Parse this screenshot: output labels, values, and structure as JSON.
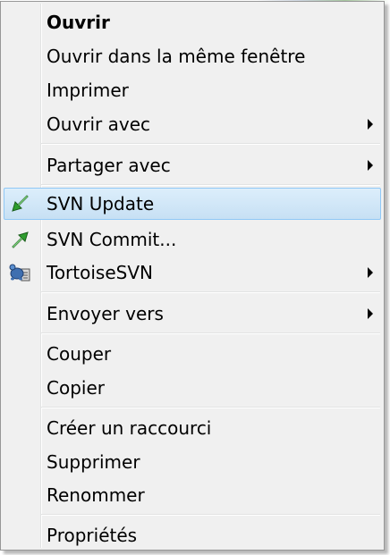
{
  "menu": {
    "items": [
      {
        "label": "Ouvrir"
      },
      {
        "label": "Ouvrir dans la même fenêtre"
      },
      {
        "label": "Imprimer"
      },
      {
        "label": "Ouvrir avec"
      },
      {
        "label": "Partager avec"
      },
      {
        "label": "SVN Update"
      },
      {
        "label": "SVN Commit..."
      },
      {
        "label": "TortoiseSVN"
      },
      {
        "label": "Envoyer vers"
      },
      {
        "label": "Couper"
      },
      {
        "label": "Copier"
      },
      {
        "label": "Créer un raccourci"
      },
      {
        "label": "Supprimer"
      },
      {
        "label": "Renommer"
      },
      {
        "label": "Propriétés"
      }
    ]
  },
  "icons": {
    "svn_update": "svn-update-arrow-icon",
    "svn_commit": "svn-commit-arrow-icon",
    "tortoisesvn": "tortoisesvn-turtle-icon",
    "submenu": "chevron-right-icon"
  },
  "colors": {
    "menu_background": "#f0f0f0",
    "hover_background": "#cce4f7",
    "hover_border": "#90c8f6",
    "svn_green": "#2e9e2e"
  }
}
